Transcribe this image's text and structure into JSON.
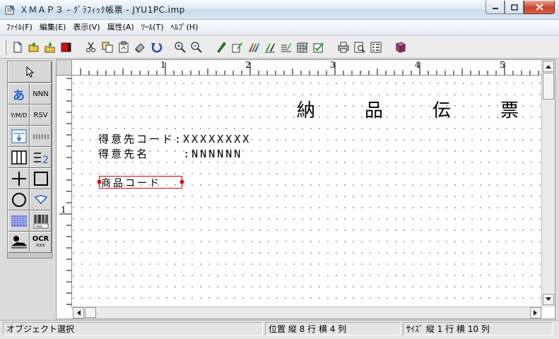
{
  "window": {
    "title": "ＸＭＡＰ３ - ｸﾞﾗﾌｨｯｸ帳票 - JYU1PC.imp",
    "buttons": [
      "minimize",
      "maximize",
      "close"
    ]
  },
  "menu": [
    {
      "label": "ﾌｧｲﾙ(F)"
    },
    {
      "label": "編集(E)"
    },
    {
      "label": "表示(V)"
    },
    {
      "label": "属性(A)"
    },
    {
      "label": "ﾂｰﾙ(T)"
    },
    {
      "label": "ﾍﾙﾌﾟ(H)"
    }
  ],
  "toolbar": {
    "icons": [
      "new-icon",
      "open-icon",
      "save-icon",
      "record-icon",
      "cut-icon",
      "copy-icon",
      "paste-icon",
      "eraser-icon",
      "undo-icon",
      "zoom-in-icon",
      "zoom-out-icon",
      "pen-icon",
      "edit-icon",
      "multi-pen-icon",
      "draw-icon",
      "format-icon",
      "grid-icon",
      "check-icon",
      "print-icon",
      "print-preview-icon",
      "layout-icon",
      "book-icon"
    ]
  },
  "palette": {
    "text_tool": "あ",
    "numeric_tool": "NNN",
    "date_tool": "Y/M/D",
    "reserve_tool": "RSV",
    "ocr_tool": "OCR"
  },
  "ruler": {
    "h_labels": [
      "1",
      "2",
      "3",
      "4",
      "5"
    ],
    "v_labels": [
      "1"
    ]
  },
  "document": {
    "title_chars": [
      "納",
      "品",
      "伝",
      "票"
    ],
    "customer_code": "得意先コード:XXXXXXXX",
    "customer_name": "得意先名    :NNNNNN",
    "product_code": "商品コード"
  },
  "status": {
    "message": "オブジェクト選択",
    "position": "位置 縦 8  行 横 4   列",
    "size": "ｻｲｽﾞ 縦 1  行 横 10  列"
  },
  "colors": {
    "selection": "#e00000",
    "text_tool_accent": "#1a5fd0"
  }
}
